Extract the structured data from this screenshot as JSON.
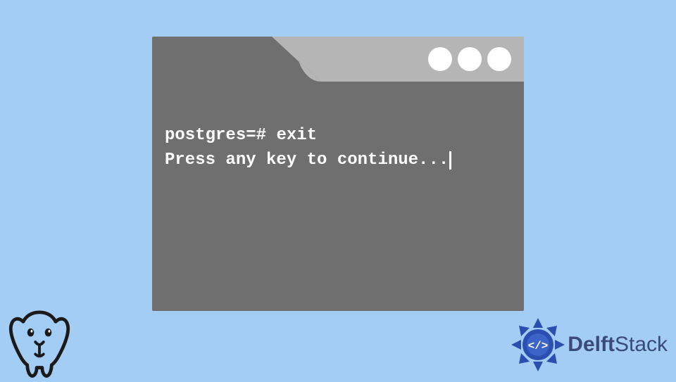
{
  "terminal": {
    "line1_prompt": "postgres=#",
    "line1_cmd": "exit",
    "line2": "Press any key to continue..."
  },
  "brand": {
    "delft": "Delft",
    "stack": "Stack"
  },
  "icons": {
    "postgres": "postgresql-elephant",
    "delft_medallion": "code-medallion"
  },
  "colors": {
    "page_bg": "#a3cdf5",
    "term_bg": "#6f6f6f",
    "titlebar": "#b5b5b5",
    "text": "#ffffff",
    "brand_blue": "#2b4fb0"
  }
}
